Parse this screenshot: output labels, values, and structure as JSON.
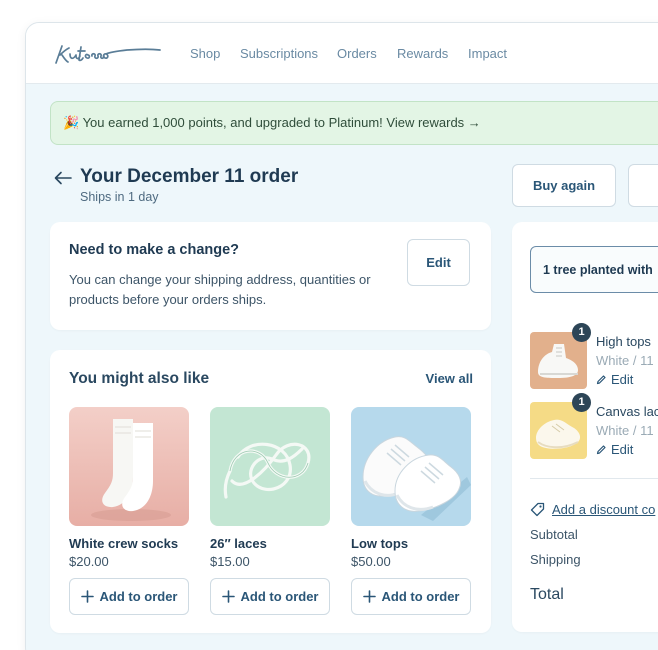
{
  "nav": {
    "logo": "Kutsoo",
    "links": [
      "Shop",
      "Subscriptions",
      "Orders",
      "Rewards",
      "Impact"
    ]
  },
  "banner": {
    "emoji": "🎉",
    "text": "You earned 1,000 points, and upgraded to Platinum! View rewards →"
  },
  "order": {
    "title": "Your December 11 order",
    "subtitle": "Ships in 1 day",
    "buy_again": "Buy again"
  },
  "change_card": {
    "title": "Need to make a change?",
    "description": "You can change your shipping address, quantities or products before your orders ships.",
    "edit": "Edit"
  },
  "recommendations": {
    "title": "You might also like",
    "view_all": "View all",
    "add_label": "Add to order",
    "products": [
      {
        "name": "White crew socks",
        "price": "$20.00"
      },
      {
        "name": "26″ laces",
        "price": "$15.00"
      },
      {
        "name": "Low tops",
        "price": "$50.00"
      }
    ]
  },
  "summary": {
    "tree_text": "1 tree planted with",
    "items": [
      {
        "qty": "1",
        "name": "High tops",
        "variant": "White / 11",
        "edit": "Edit"
      },
      {
        "qty": "1",
        "name": "Canvas lac",
        "variant": "White / 11",
        "edit": "Edit"
      }
    ],
    "discount": "Add a discount co",
    "subtotal_label": "Subtotal",
    "shipping_label": "Shipping",
    "total_label": "Total"
  },
  "colors": {
    "page_bg": "#eef7fb",
    "banner_bg": "#e3f5e5",
    "accent_text": "#2a5677",
    "heading": "#1f3a52"
  }
}
